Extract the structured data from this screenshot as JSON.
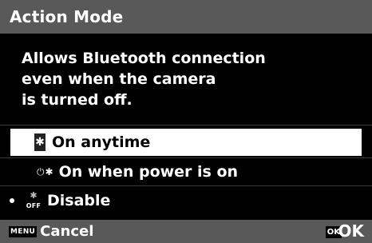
{
  "header": {
    "title": "Action Mode"
  },
  "description": {
    "lines": [
      "Allows Bluetooth connection",
      "even when the camera",
      "is turned off."
    ]
  },
  "options": [
    {
      "label": "On anytime",
      "icon": "bluetooth-icon",
      "glyph": "✱",
      "selected": true
    },
    {
      "label": "On when power is on",
      "icon": "power-bluetooth-icon",
      "glyph_power": "⏻",
      "glyph_bt": "✱",
      "selected": false
    },
    {
      "label": "Disable",
      "icon": "bluetooth-off-icon",
      "glyph_bt": "✱",
      "off_text": "OFF",
      "selected": false,
      "current": true
    }
  ],
  "footer": {
    "menu_badge": "MENU",
    "cancel_label": "Cancel",
    "ok_badge": "OK",
    "ok_label": "OK"
  },
  "colors": {
    "bar": "#595959",
    "background": "#000000",
    "selected_bg": "#ffffff"
  }
}
